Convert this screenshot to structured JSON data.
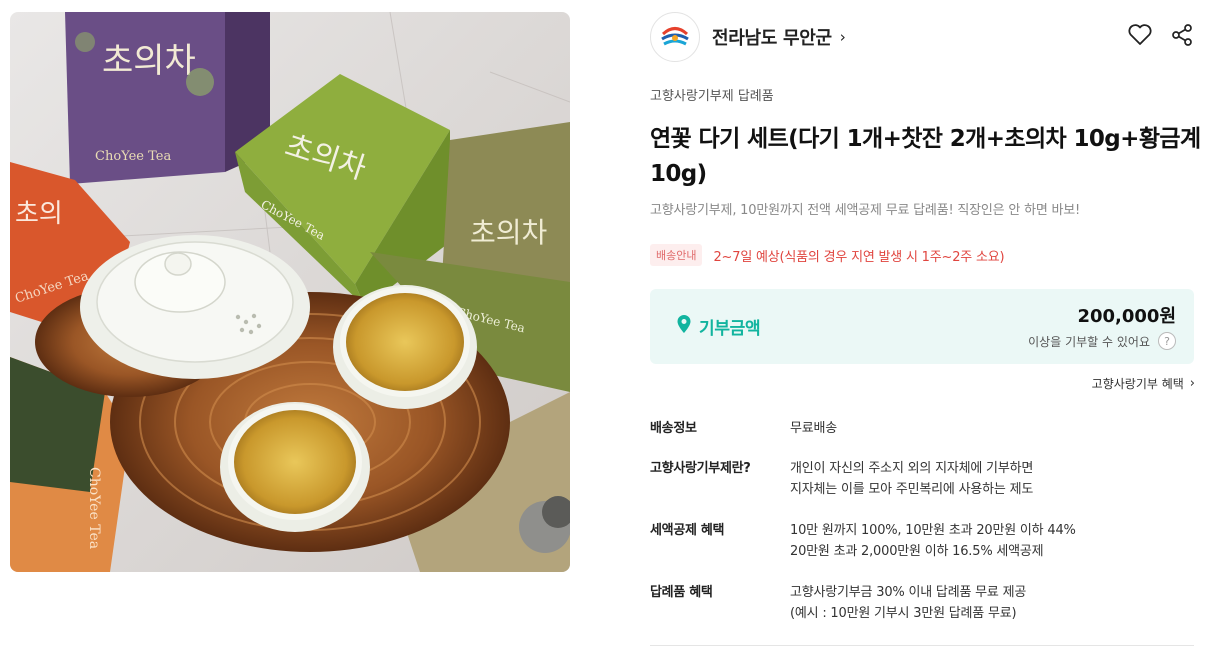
{
  "seller": {
    "name": "전라남도 무안군",
    "arrow": "›"
  },
  "product": {
    "category": "고향사랑기부제 답례품",
    "title": "연꽃 다기 세트(다기 1개+찻잔 2개+초의차 10g+황금계 10g)",
    "subtitle": "고향사랑기부제, 10만원까지 전액 세액공제 무료 답례품! 직장인은 안 하면 바보!"
  },
  "image_text": {
    "brand_label": "ChoYee Tea"
  },
  "delivery": {
    "badge": "배송안내",
    "text": "2~7일 예상(식품의 경우 지연 발생 시 1주~2주 소요)"
  },
  "donation": {
    "label": "기부금액",
    "amount": "200,000원",
    "note": "이상을 기부할 수 있어요",
    "help": "?"
  },
  "benefit_link": {
    "label": "고향사랑기부 혜택",
    "chevron": "›"
  },
  "info": [
    {
      "label": "배송정보",
      "lines": [
        "무료배송"
      ]
    },
    {
      "label": "고향사랑기부제란?",
      "lines": [
        "개인이 자신의 주소지 외의 지자체에 기부하면",
        "지자체는 이를 모아 주민복리에 사용하는 제도"
      ]
    },
    {
      "label": "세액공제 혜택",
      "lines": [
        "10만 원까지 100%, 10만원 초과 20만원 이하 44%",
        "20만원 초과 2,000만원 이하 16.5% 세액공제"
      ]
    },
    {
      "label": "답례품 혜택",
      "lines": [
        "고향사랑기부금 30% 이내 답례품 무료 제공",
        "(예시 : 10만원 기부시 3만원 답례품 무료)"
      ]
    }
  ],
  "colors": {
    "accent": "#12b49f",
    "donation_bg": "#ebf8f6",
    "delivery_text": "#e0453f",
    "badge_bg": "#fdeeee"
  },
  "icons": {
    "heart": "heart-icon",
    "share": "share-icon",
    "pin": "location-pin-icon",
    "help": "help-circle-icon"
  }
}
